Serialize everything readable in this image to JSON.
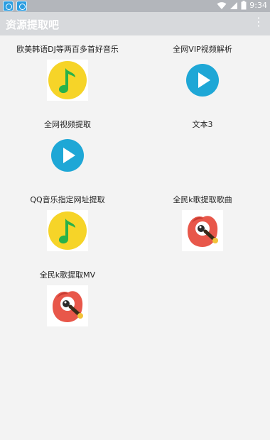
{
  "status_bar": {
    "time": "9:34",
    "wifi_icon": "wifi-icon",
    "signal_icon": "signal-icon",
    "battery_icon": "battery-icon"
  },
  "app_bar": {
    "title": "资源提取吧",
    "menu_icon": "more-vert-icon"
  },
  "tiles": [
    {
      "label": "欧美韩语DJ等两百多首好音乐",
      "icon": "qq-music-icon"
    },
    {
      "label": "全网VIP视频解析",
      "icon": "play-icon"
    },
    {
      "label": "全网视频提取",
      "icon": "play-icon"
    },
    {
      "label": "文本3",
      "icon": ""
    },
    {
      "label": "QQ音乐指定网址提取",
      "icon": "qq-music-icon"
    },
    {
      "label": "全民k歌提取歌曲",
      "icon": "kge-icon"
    },
    {
      "label": "全民k歌提取MV",
      "icon": "kge-icon"
    }
  ],
  "colors": {
    "status_bar": "#b3b6bb",
    "app_bar": "#d7d9dc",
    "background": "#f3f3f3",
    "qq_yellow": "#f6d428",
    "qq_green": "#28b24a",
    "play_blue": "#1ea7d6",
    "kge_red": "#e8574a"
  }
}
